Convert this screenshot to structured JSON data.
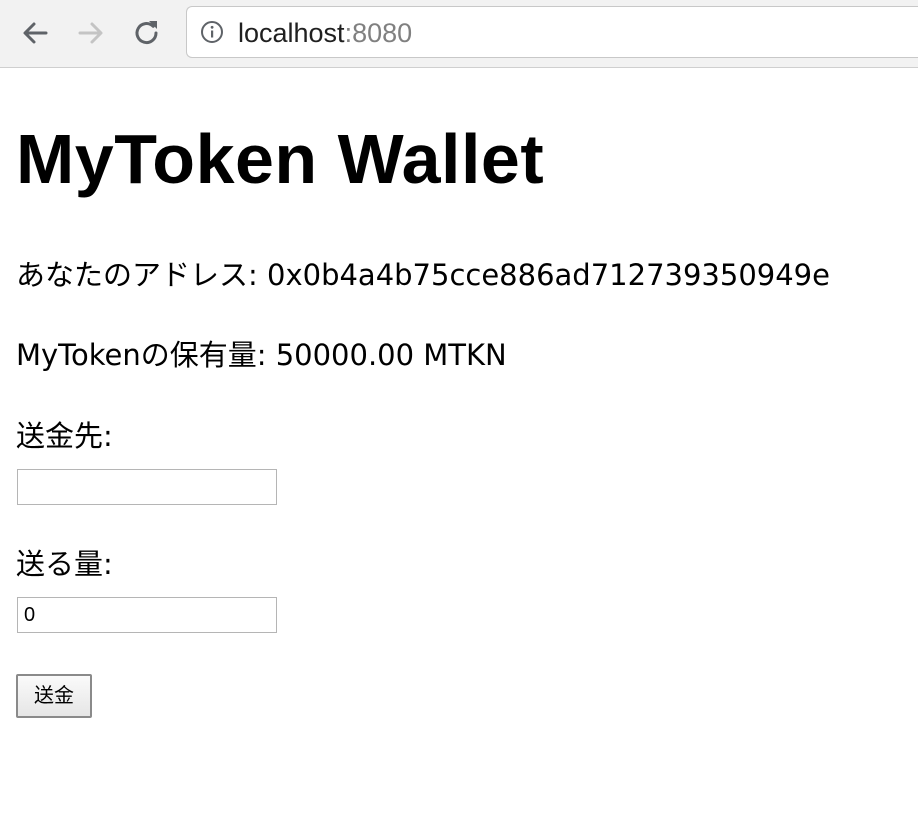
{
  "browser": {
    "url_host": "localhost",
    "url_port": ":8080",
    "icons": {
      "back": "arrow-left-icon",
      "forward": "arrow-right-icon",
      "reload": "reload-icon",
      "info": "info-icon"
    }
  },
  "page": {
    "title": "MyToken Wallet",
    "address_label": "あなたのアドレス: ",
    "address_value": "0x0b4a4b75cce886ad712739350949e",
    "balance_label": "MyTokenの保有量: ",
    "balance_value": "50000.00 MTKN",
    "form": {
      "to_label": "送金先:",
      "to_value": "",
      "amount_label": "送る量:",
      "amount_value": "0",
      "send_label": "送金"
    }
  }
}
